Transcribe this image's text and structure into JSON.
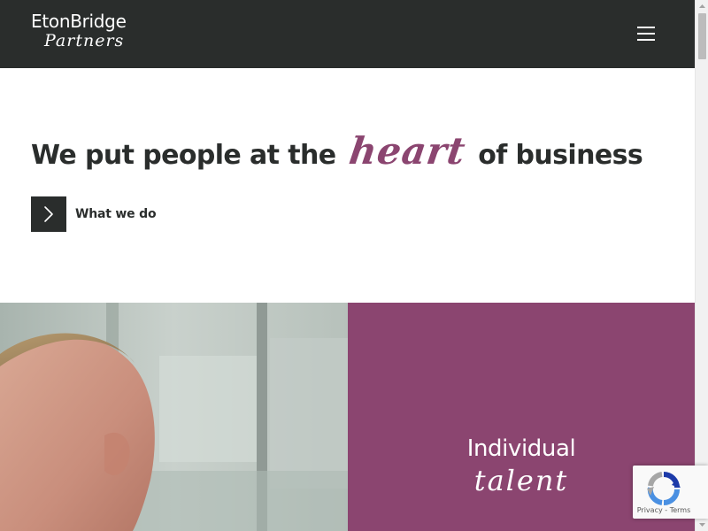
{
  "header": {
    "logo_main": "EtonBridge",
    "logo_script": "Partners",
    "menu_icon": "hamburger-menu-icon"
  },
  "hero": {
    "headline_start": "We put people at the",
    "headline_accent": "heart",
    "headline_end": "of business",
    "cta_label": "What we do",
    "cta_icon": "chevron-right-icon"
  },
  "panel": {
    "title": "Individual",
    "script": "talent"
  },
  "recaptcha": {
    "privacy": "Privacy",
    "separator": "-",
    "terms": "Terms"
  },
  "colors": {
    "header_bg": "#2a2d2c",
    "accent": "#8b4570",
    "text": "#2a2d2c",
    "white": "#ffffff"
  }
}
